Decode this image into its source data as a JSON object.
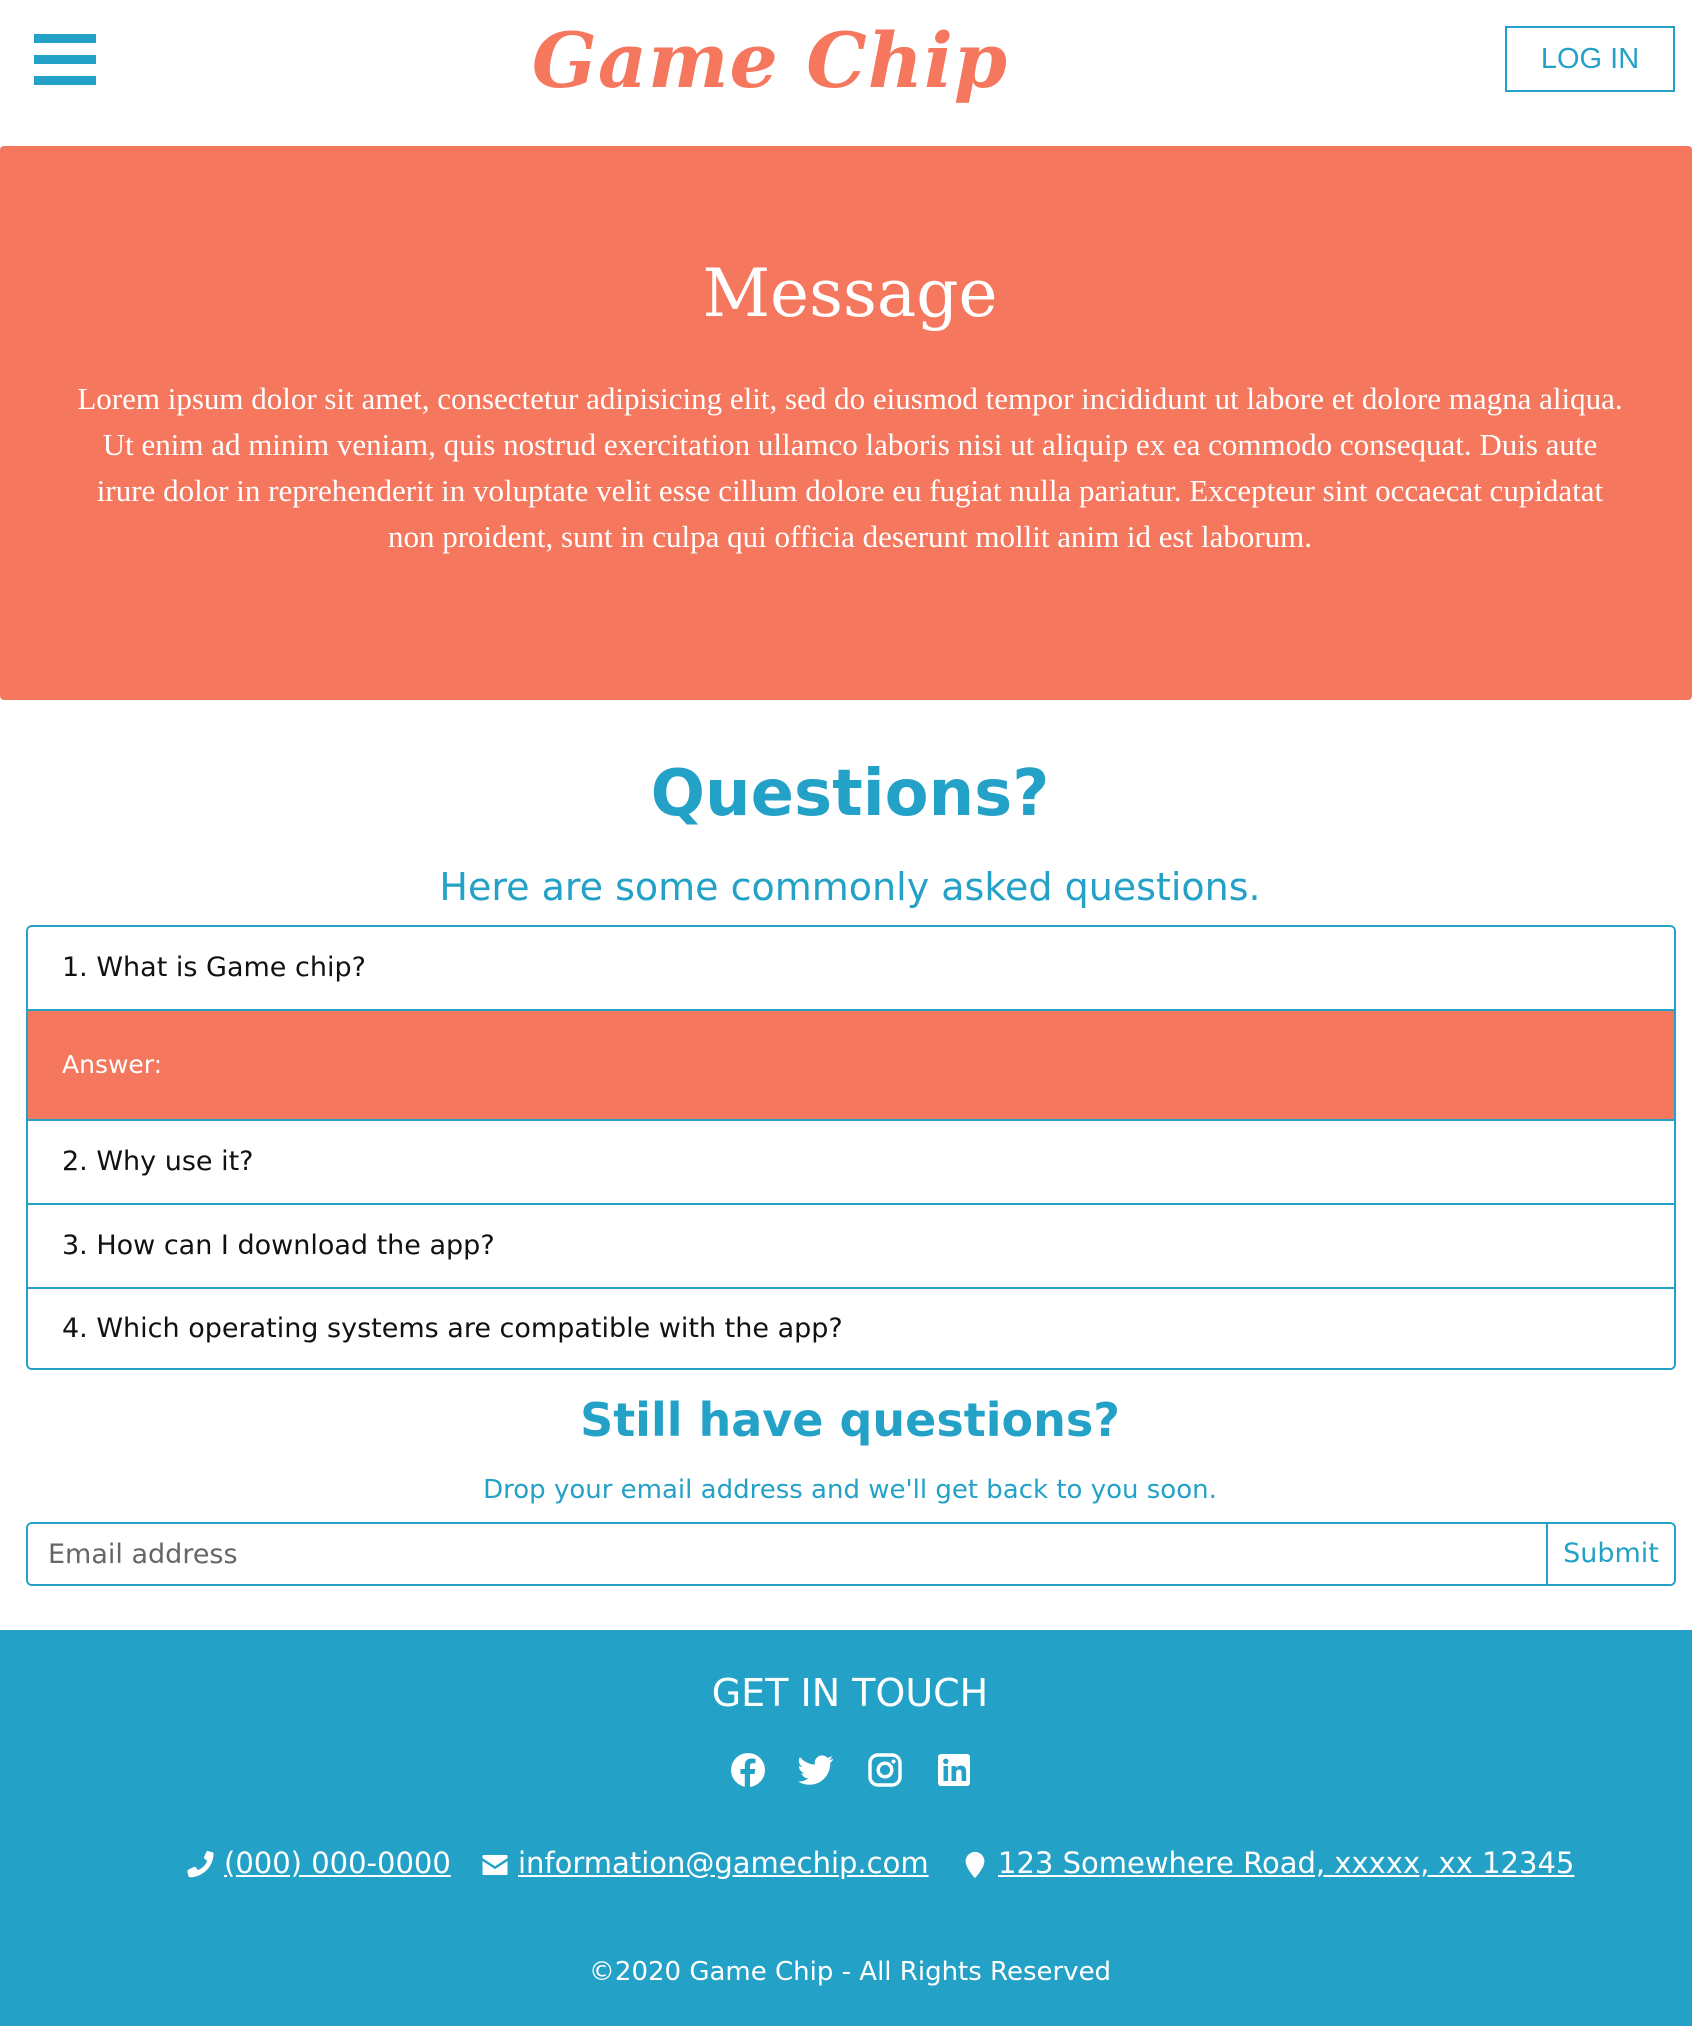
{
  "header": {
    "logo": "Game Chip",
    "login_label": "LOG IN"
  },
  "hero": {
    "title": "Message",
    "text": "Lorem ipsum dolor sit amet, consectetur adipisicing elit, sed do eiusmod tempor incididunt ut labore et dolore magna aliqua. Ut enim ad minim veniam, quis nostrud exercitation ullamco laboris nisi ut aliquip ex ea commodo consequat. Duis aute irure dolor in reprehenderit in voluptate velit esse cillum dolore eu fugiat nulla pariatur. Excepteur sint occaecat cupidatat non proident, sunt in culpa qui officia deserunt mollit anim id est laborum."
  },
  "questions": {
    "title": "Questions?",
    "subtitle": "Here are some commonly asked questions.",
    "items": [
      {
        "question": "1. What is Game chip?",
        "answer": "Answer:"
      },
      {
        "question": "2. Why use it?"
      },
      {
        "question": "3. How can I download the app?"
      },
      {
        "question": "4. Which operating systems are compatible with the app?"
      }
    ]
  },
  "still": {
    "title": "Still have questions?",
    "subtitle": "Drop your email address and we'll get back to you soon.",
    "email_placeholder": "Email address",
    "submit_label": "Submit"
  },
  "footer": {
    "title": "GET IN TOUCH",
    "social": [
      "facebook-icon",
      "twitter-icon",
      "instagram-icon",
      "linkedin-icon"
    ],
    "phone": "(000) 000-0000",
    "email": "information@gamechip.com",
    "address": "123 Somewhere Road, xxxxx, xx 12345",
    "copyright": "©2020 Game Chip - All Rights Reserved"
  },
  "colors": {
    "accent_blue": "#24a1c7",
    "accent_coral": "#f4775e"
  }
}
